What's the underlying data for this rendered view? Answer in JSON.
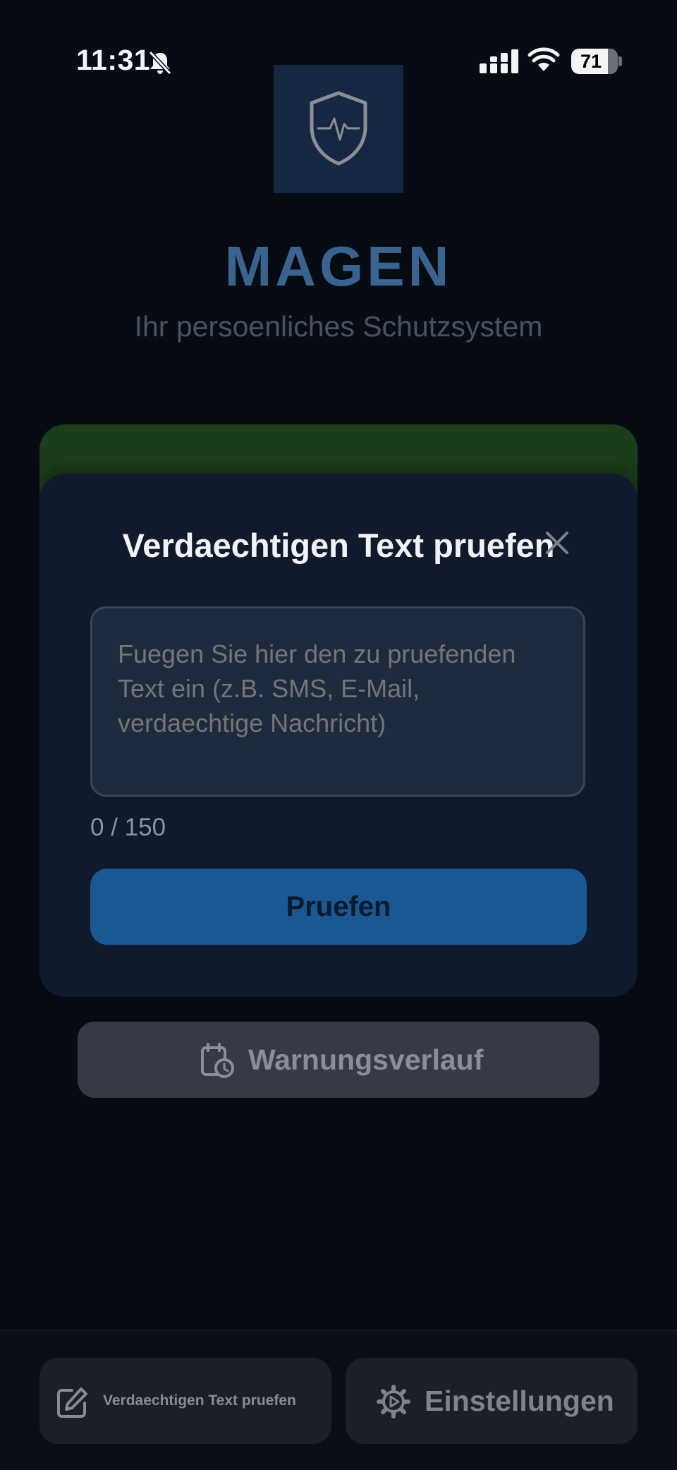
{
  "status_bar": {
    "time": "11:31",
    "battery": "71",
    "icons": [
      "bell-slash-icon",
      "signal-icon",
      "wifi-icon",
      "battery-icon"
    ]
  },
  "header": {
    "logo_icon": "shield-heartbeat-icon",
    "title": "MAGEN",
    "subtitle": "Ihr persoenliches Schutzsystem"
  },
  "modal": {
    "title": "Verdaechtigen Text pruefen",
    "close_icon": "close-icon",
    "input_value": "",
    "input_placeholder": "Fuegen Sie hier den zu pruefenden Text ein (z.B. SMS, E-Mail, verdaechtige Nachricht)",
    "char_count": "0 / 150",
    "submit_label": "Pruefen"
  },
  "history_button": {
    "icon": "calendar-clock-icon",
    "label": "Warnungsverlauf"
  },
  "bottom_nav": {
    "check_text": {
      "icon": "edit-icon",
      "label": "Verdaechtigen Text pruefen"
    },
    "settings": {
      "icon": "gear-icon",
      "label": "Einstellungen"
    }
  },
  "colors": {
    "background": "#070b14",
    "accent_blue": "#1a5894",
    "title_blue": "#3a6390",
    "status_green": "#1c3d1b",
    "modal_bg": "#111a2c"
  }
}
